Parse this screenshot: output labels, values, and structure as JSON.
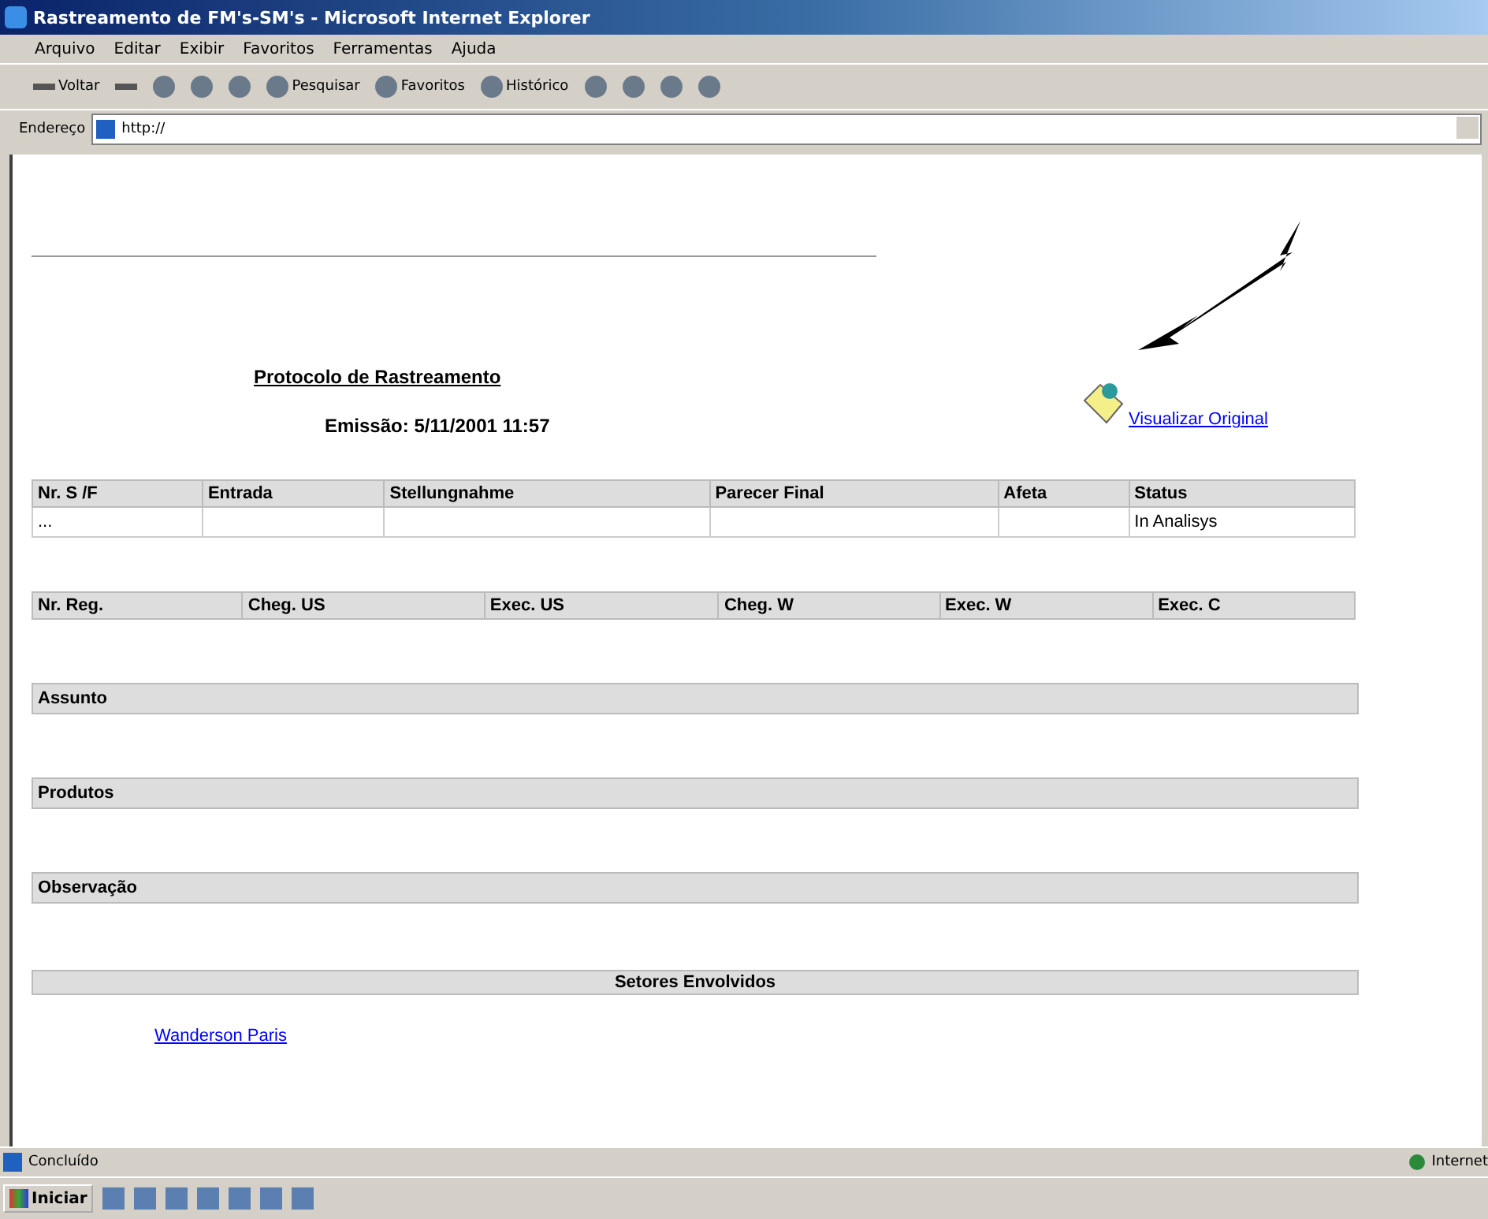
{
  "window": {
    "title": "Rastreamento de FM's-SM's - Microsoft Internet Explorer"
  },
  "menu": [
    "Arquivo",
    "Editar",
    "Exibir",
    "Favoritos",
    "Ferramentas",
    "Ajuda"
  ],
  "toolbar": [
    {
      "kind": "back",
      "label": "Voltar"
    },
    {
      "kind": "forward"
    },
    {
      "kind": "stop"
    },
    {
      "kind": "refresh"
    },
    {
      "kind": "home"
    },
    {
      "kind": "search",
      "label": "Pesquisar"
    },
    {
      "kind": "favorites",
      "label": "Favoritos"
    },
    {
      "kind": "history",
      "label": "Histórico"
    },
    {
      "kind": "mail"
    },
    {
      "kind": "print"
    },
    {
      "kind": "edit"
    },
    {
      "kind": "discuss"
    }
  ],
  "address": {
    "label": "Endereço",
    "value": "http://"
  },
  "page": {
    "title": "Protocolo de Rastreamento",
    "emission": "Emissão: 5/11/2001 11:57",
    "link": "Visualizar Original",
    "table1": {
      "columns": [
        "Nr. S   /F",
        "Entrada",
        "Stellungnahme",
        "Parecer Final",
        "Afeta",
        "Status"
      ],
      "row": {
        "nr": "...",
        "status": "In Analisys"
      }
    },
    "table2": {
      "columns": [
        "Nr. Reg.",
        "Cheg.    US",
        "Exec.    US",
        "Cheg.    W",
        "Exec.    W",
        "Exec. C"
      ]
    },
    "sections": [
      "Assunto",
      "Produtos",
      "Observação",
      "Setores Envolvidos"
    ],
    "author": "Wanderson Paris"
  },
  "status_bar": {
    "text": "Concluído",
    "zone": "Internet"
  },
  "taskbar": {
    "start": "Iniciar"
  }
}
